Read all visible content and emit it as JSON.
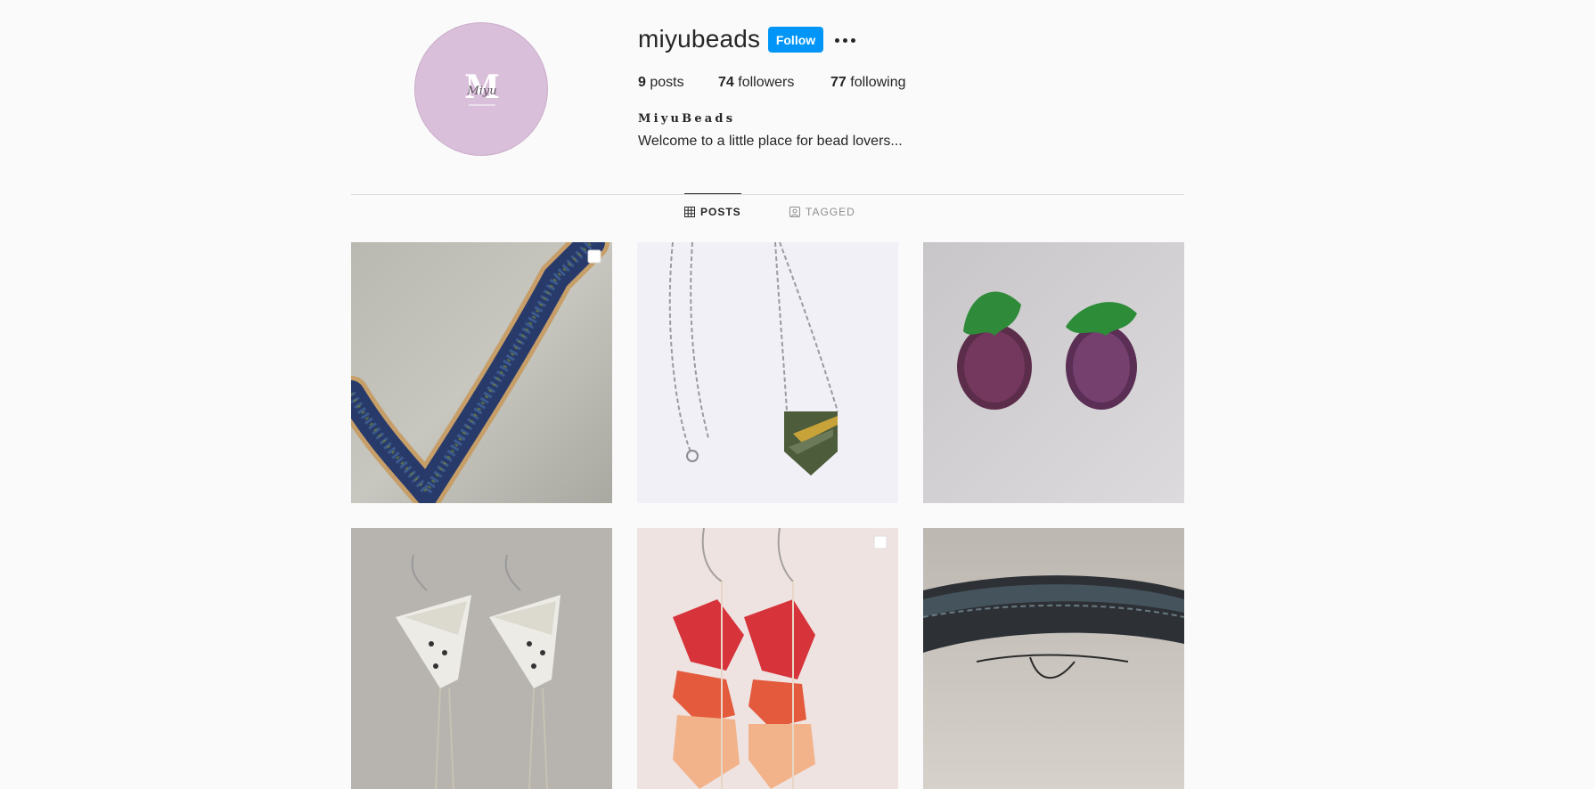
{
  "profile": {
    "username": "miyubeads",
    "follow_label": "Follow",
    "more_icon": "more-options-icon",
    "avatar": {
      "monogram": "M",
      "script": "Miyu"
    },
    "stats": [
      {
        "count": "9",
        "label": "posts"
      },
      {
        "count": "74",
        "label": "followers"
      },
      {
        "count": "77",
        "label": "following"
      }
    ],
    "bio_name": "MiyuBeads",
    "bio_text": "Welcome to a little place for bead lovers..."
  },
  "tabs": [
    {
      "label": "POSTS",
      "icon": "grid-icon",
      "active": true
    },
    {
      "label": "TAGGED",
      "icon": "tagged-icon",
      "active": false
    }
  ],
  "colors": {
    "accent": "#0095f6",
    "avatar_bg": "#dabfda"
  },
  "posts": [
    {
      "subject": "blue beaded v-necklace",
      "multi": true
    },
    {
      "subject": "beaded pendant on silver chain",
      "multi": false
    },
    {
      "subject": "beaded raspberry earrings",
      "multi": false
    },
    {
      "subject": "beaded triangle earrings",
      "multi": false
    },
    {
      "subject": "red beaded feather earrings",
      "multi": true
    },
    {
      "subject": "dark beaded bracelet",
      "multi": false
    }
  ]
}
